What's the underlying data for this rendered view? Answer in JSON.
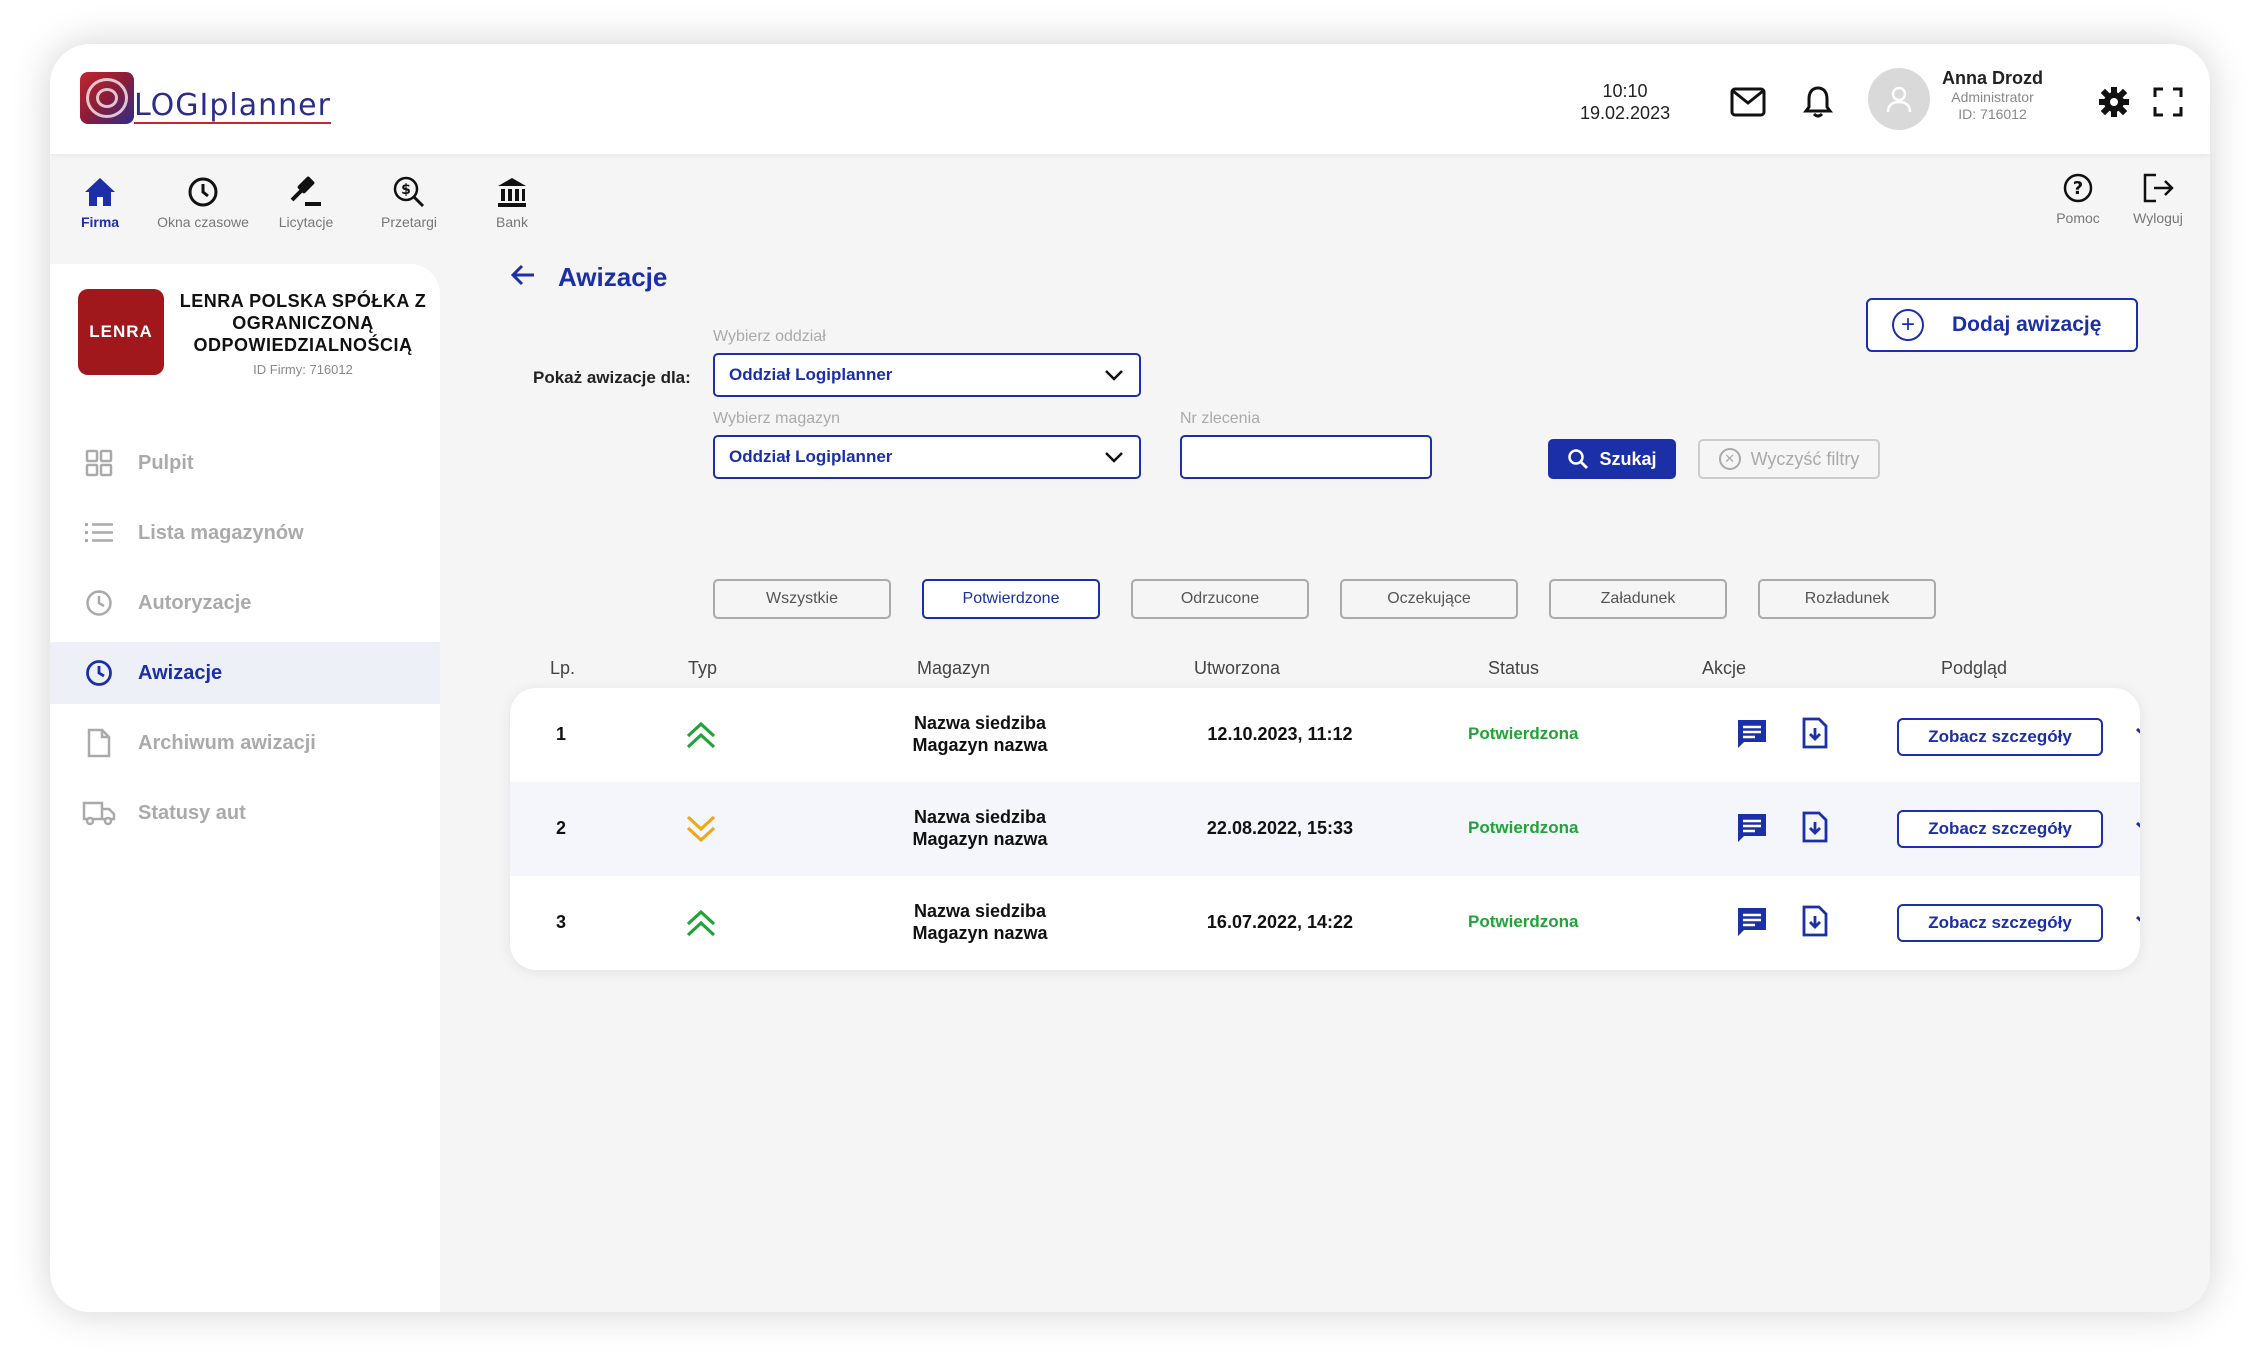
{
  "app": {
    "logo_text": "LOGIplanner"
  },
  "header": {
    "time": "10:10",
    "date": "19.02.2023",
    "user": {
      "name": "Anna Drozd",
      "role": "Administrator",
      "id": "ID: 716012"
    }
  },
  "topnav": {
    "items": [
      {
        "label": "Firma",
        "icon": "home-icon",
        "active": true
      },
      {
        "label": "Okna czasowe",
        "icon": "clock-icon"
      },
      {
        "label": "Licytacje",
        "icon": "gavel-icon"
      },
      {
        "label": "Przetargi",
        "icon": "search-dollar-icon"
      },
      {
        "label": "Bank",
        "icon": "bank-icon"
      }
    ],
    "help": "Pomoc",
    "logout": "Wyloguj"
  },
  "company": {
    "logo": "LENRA",
    "name": "LENRA POLSKA SPÓŁKA Z OGRANICZONĄ ODPOWIEDZIALNOŚCIĄ",
    "id": "ID Firmy: 716012"
  },
  "sidebar": {
    "items": [
      {
        "label": "Pulpit",
        "icon": "grid-icon"
      },
      {
        "label": "Lista magazynów",
        "icon": "list-icon"
      },
      {
        "label": "Autoryzacje",
        "icon": "clock-icon"
      },
      {
        "label": "Awizacje",
        "icon": "clock-icon",
        "active": true
      },
      {
        "label": "Archiwum awizacji",
        "icon": "document-icon"
      },
      {
        "label": "Statusy aut",
        "icon": "truck-icon"
      }
    ]
  },
  "page": {
    "title": "Awizacje",
    "add_button": "Dodaj awizację",
    "show_for_label": "Pokaż awizacje dla:",
    "branch_label": "Wybierz oddział",
    "branch_value": "Oddział Logiplanner",
    "warehouse_label": "Wybierz magazyn",
    "warehouse_value": "Oddział Logiplanner",
    "order_label": "Nr zlecenia",
    "order_value": "",
    "search_button": "Szukaj",
    "clear_button": "Wyczyść filtry"
  },
  "tabs": [
    "Wszystkie",
    "Potwierdzone",
    "Odrzucone",
    "Oczekujące",
    "Załadunek",
    "Rozładunek"
  ],
  "active_tab": "Potwierdzone",
  "table": {
    "headers": [
      "Lp.",
      "Typ",
      "Magazyn",
      "Utworzona",
      "Status",
      "Akcje",
      "Podgląd"
    ],
    "rows": [
      {
        "lp": "1",
        "type": "up",
        "site": "Nazwa siedziba",
        "warehouse": "Magazyn nazwa",
        "created": "12.10.2023, 11:12",
        "status": "Potwierdzona",
        "view": "Zobacz szczegóły"
      },
      {
        "lp": "2",
        "type": "down",
        "site": "Nazwa siedziba",
        "warehouse": "Magazyn nazwa",
        "created": "22.08.2022, 15:33",
        "status": "Potwierdzona",
        "view": "Zobacz szczegóły"
      },
      {
        "lp": "3",
        "type": "up",
        "site": "Nazwa siedziba",
        "warehouse": "Magazyn nazwa",
        "created": "16.07.2022, 14:22",
        "status": "Potwierdzona",
        "view": "Zobacz szczegóły"
      }
    ]
  },
  "colors": {
    "accent": "#1a2fa8",
    "success": "#21a339",
    "warning": "#f0a818",
    "brand_red": "#a0171c"
  }
}
